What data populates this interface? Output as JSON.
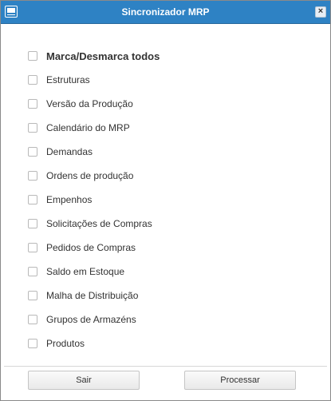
{
  "window": {
    "title": "Sincronizador MRP",
    "close_symbol": "×",
    "icon": "app-window-icon",
    "accent_color": "#2e82c4"
  },
  "options": [
    {
      "label": "Marca/Desmarca todos",
      "checked": false
    },
    {
      "label": "Estruturas",
      "checked": false
    },
    {
      "label": "Versão da Produção",
      "checked": false
    },
    {
      "label": "Calendário do MRP",
      "checked": false
    },
    {
      "label": "Demandas",
      "checked": false
    },
    {
      "label": "Ordens de produção",
      "checked": false
    },
    {
      "label": "Empenhos",
      "checked": false
    },
    {
      "label": "Solicitações de Compras",
      "checked": false
    },
    {
      "label": "Pedidos de Compras",
      "checked": false
    },
    {
      "label": "Saldo em Estoque",
      "checked": false
    },
    {
      "label": "Malha de Distribuição",
      "checked": false
    },
    {
      "label": "Grupos de Armazéns",
      "checked": false
    },
    {
      "label": "Produtos",
      "checked": false
    }
  ],
  "footer": {
    "exit_label": "Sair",
    "process_label": "Processar"
  }
}
